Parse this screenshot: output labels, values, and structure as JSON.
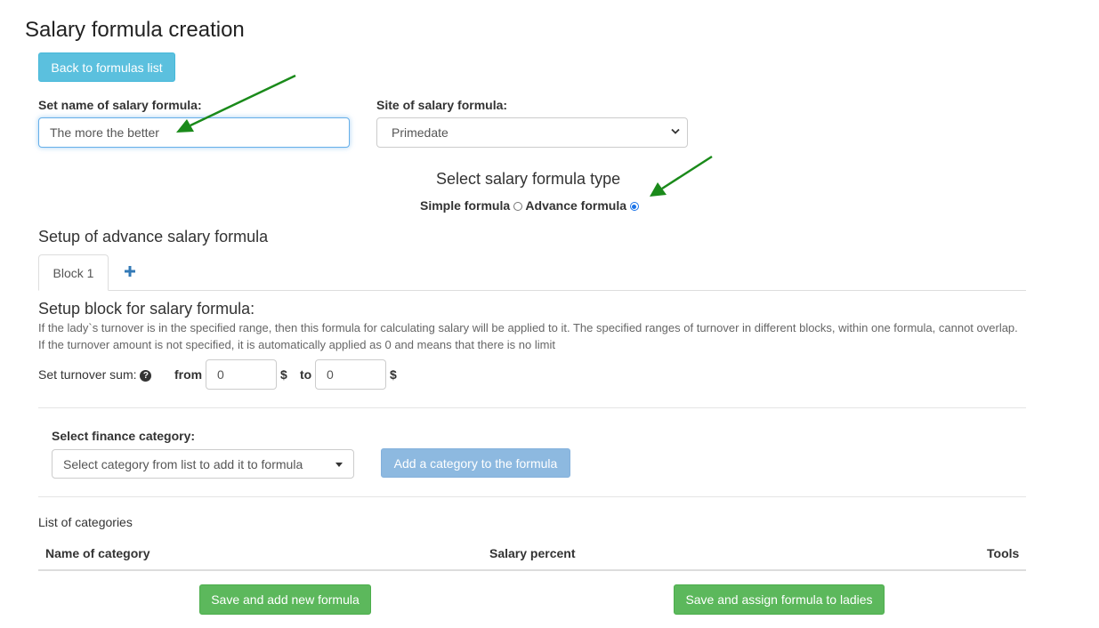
{
  "page": {
    "title": "Salary formula creation"
  },
  "back_button": {
    "label": "Back to formulas list"
  },
  "formula_name": {
    "label": "Set name of salary formula:",
    "value": "The more the better"
  },
  "site": {
    "label": "Site of salary formula:",
    "value": "Primedate"
  },
  "formula_type": {
    "title": "Select salary formula type",
    "simple_label": "Simple formula",
    "advance_label": "Advance formula",
    "selected": "advance"
  },
  "advance_setup": {
    "title": "Setup of advance salary formula"
  },
  "tabs": {
    "block_label": "Block 1",
    "add_icon": "plus-icon"
  },
  "block": {
    "title": "Setup block for salary formula:",
    "description": "If the lady`s turnover is in the specified range, then this formula for calculating salary will be applied to it. The specified ranges of turnover in different blocks, within one formula, cannot overlap. If the turnover amount is not specified, it is automatically applied as 0 and means that there is no limit",
    "turnover_label": "Set turnover sum:",
    "help_icon": "question-circle-icon",
    "from_label": "from",
    "from_value": "0",
    "to_label": "to",
    "to_value": "0",
    "currency": "$"
  },
  "finance": {
    "label": "Select finance category:",
    "placeholder": "Select category from list to add it to formula",
    "add_button": "Add a category to the formula"
  },
  "categories": {
    "title": "List of categories",
    "columns": [
      "Name of category",
      "Salary percent",
      "Tools"
    ],
    "rows": []
  },
  "actions": {
    "save_new": "Save and add new formula",
    "save_assign": "Save and assign formula to ladies"
  },
  "colors": {
    "info": "#5bc0de",
    "success": "#5cb85c",
    "primary_disabled": "#8db9e0",
    "plus_icon": "#337ab7",
    "annotation_arrow": "#1a8a1a"
  }
}
